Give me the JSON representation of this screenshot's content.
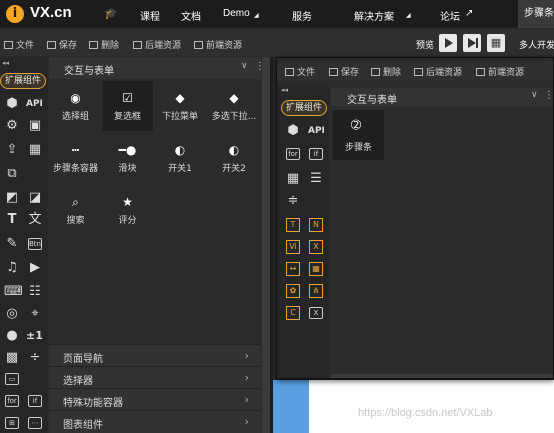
{
  "nav": {
    "logo_letter": "i",
    "logo_text": "VX.cn",
    "items": [
      "课程",
      "文档",
      "Demo",
      "服务",
      "解决方案",
      "论坛"
    ],
    "active_tab": "步骤条"
  },
  "toolbar": {
    "file": "文件",
    "save": "保存",
    "delete": "删除",
    "backend": "后端资源",
    "frontend": "前端资源",
    "preview": "预览",
    "collab": "多人开发"
  },
  "rail": {
    "ext_tag": "扩展组件",
    "api": "API",
    "for": "for",
    "if": "if",
    "btn": "Btn",
    "pm": "±1"
  },
  "left_panel": {
    "header": "交互与表单",
    "cells": [
      {
        "label": "选择组",
        "icon": "radio-icon"
      },
      {
        "label": "复选框",
        "icon": "checkbox-icon"
      },
      {
        "label": "下拉菜单",
        "icon": "dropdown-icon"
      },
      {
        "label": "多选下拉...",
        "icon": "multi-dropdown-icon"
      },
      {
        "label": "步骤条容器",
        "icon": "steps-container-icon"
      },
      {
        "label": "滑块",
        "icon": "slider-icon"
      },
      {
        "label": "开关1",
        "icon": "switch-icon"
      },
      {
        "label": "开关2",
        "icon": "switch-icon"
      },
      {
        "label": "搜索",
        "icon": "search-icon"
      },
      {
        "label": "评分",
        "icon": "star-icon"
      }
    ],
    "accordions": [
      "页面导航",
      "选择器",
      "特殊功能容器",
      "图表组件"
    ]
  },
  "right_panel": {
    "ext_tag": "扩展组件",
    "api": "API",
    "for": "for",
    "if": "if",
    "header": "交互与表单",
    "cell_label": "步骤条"
  },
  "watermark": "https://blog.csdn.net/VXLab"
}
